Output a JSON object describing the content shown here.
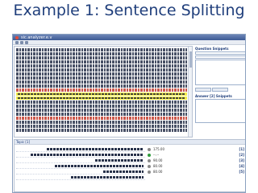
{
  "slide": {
    "title": "Example 1: Sentence Splitting"
  },
  "window": {
    "title": "sic.analyzer.e.v"
  },
  "panels": {
    "question_snippets": "Question Snippets",
    "answer": "Answer [2] Snippets",
    "topic": "Topic [1]"
  },
  "snippet_rows": [
    {
      "value": "175.00",
      "index": "[1]",
      "status": "gray"
    },
    {
      "value": "--.--",
      "index": "[2]",
      "status": "green"
    },
    {
      "value": "90.00",
      "index": "[3]",
      "status": "gray"
    },
    {
      "value": "80.00",
      "index": "[4]",
      "status": "gray"
    },
    {
      "value": "80.00",
      "index": "[5]",
      "status": "gray"
    }
  ],
  "colors": {
    "title": "#1f3e7b",
    "highlight": "#f2ec2a",
    "red_text": "#c0392b"
  }
}
